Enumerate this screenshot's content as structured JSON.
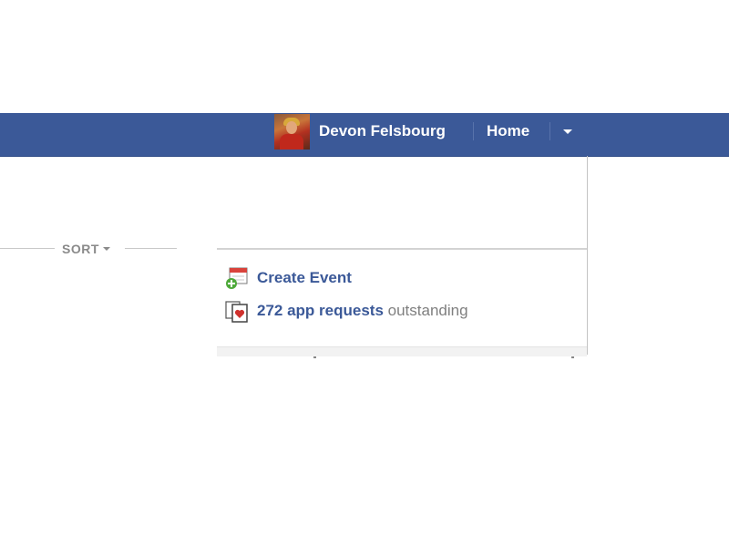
{
  "header": {
    "user_name": "Devon Felsbourg",
    "home_label": "Home",
    "bar_color": "#3b5998"
  },
  "stream": {
    "sort_label": "SORT"
  },
  "sidebar_box": {
    "create_event_label": "Create Event",
    "requests_count_label": "272 app requests",
    "requests_suffix": "outstanding"
  },
  "icons": {
    "avatar": "user-avatar",
    "menu": "chevron-down-icon",
    "create_event": "calendar-plus-icon",
    "requests": "app-request-heart-icon"
  },
  "colors": {
    "link": "#3b5998",
    "muted_text": "#7f7f7f"
  }
}
